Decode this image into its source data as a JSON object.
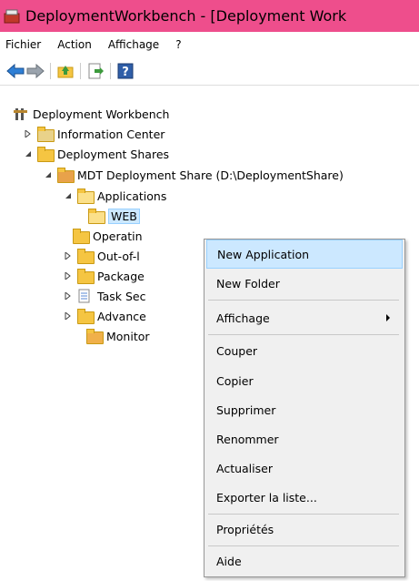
{
  "window": {
    "title": "DeploymentWorkbench - [Deployment Work"
  },
  "menubar": {
    "items": [
      "Fichier",
      "Action",
      "Affichage",
      "?"
    ]
  },
  "toolbar": {
    "help_glyph": "?"
  },
  "tree": {
    "root": "Deployment Workbench",
    "information_center": "Information Center",
    "deployment_shares": "Deployment Shares",
    "mdt_share": "MDT Deployment Share (D:\\DeploymentShare)",
    "applications": "Applications",
    "web": "WEB",
    "operating": "Operatin",
    "out_of_box": "Out-of-l",
    "packages": "Package",
    "task_seq": "Task Sec",
    "advanced": "Advance",
    "monitoring": "Monitor"
  },
  "context_menu": {
    "new_application": "New Application",
    "new_folder": "New Folder",
    "affichage": "Affichage",
    "couper": "Couper",
    "copier": "Copier",
    "supprimer": "Supprimer",
    "renommer": "Renommer",
    "actualiser": "Actualiser",
    "exporter": "Exporter la liste...",
    "proprietes": "Propriétés",
    "aide": "Aide"
  },
  "colors": {
    "titlebar": "#ee4e8c",
    "highlight": "#cce8ff",
    "folder": "#f5c542"
  }
}
